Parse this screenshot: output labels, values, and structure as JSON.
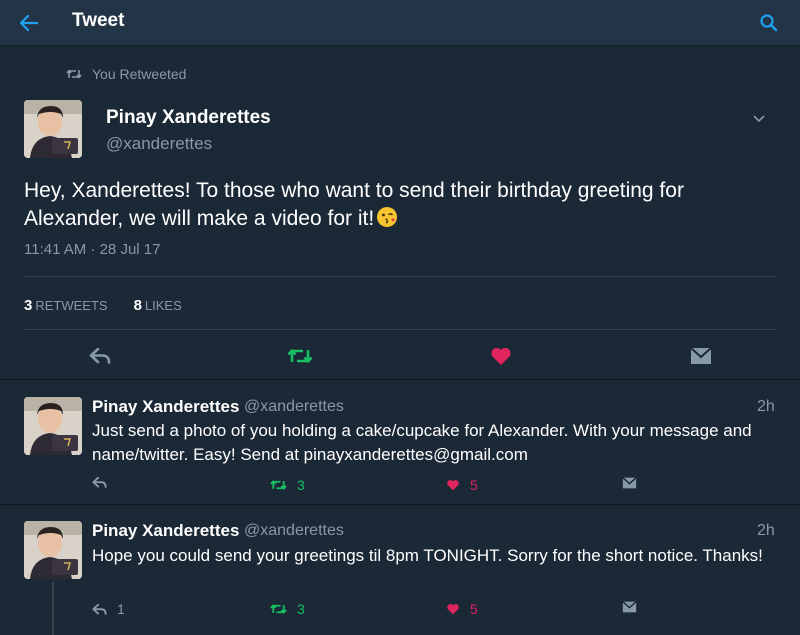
{
  "appbar": {
    "title": "Tweet"
  },
  "retweet_banner": {
    "label": "You Retweeted"
  },
  "main_tweet": {
    "name": "Pinay Xanderettes",
    "handle": "@xanderettes",
    "text": "Hey, Xanderettes! To those who want to send their birthday greeting for Alexander, we will make a video for it!",
    "timestamp": "11:41 AM · 28 Jul 17",
    "retweets_count": "3",
    "retweets_label": "RETWEETS",
    "likes_count": "8",
    "likes_label": "LIKES"
  },
  "replies": [
    {
      "name": "Pinay Xanderettes",
      "handle": "@xanderettes",
      "time": "2h",
      "text": "Just send a photo of you holding a cake/cupcake for Alexander. With your message and name/twitter. Easy! Send at pinayxanderettes@gmail.com",
      "reply_count": "",
      "retweet_count": "3",
      "like_count": "5"
    },
    {
      "name": "Pinay Xanderettes",
      "handle": "@xanderettes",
      "time": "2h",
      "text": "Hope you could send your greetings til 8pm TONIGHT. Sorry for the short notice. Thanks!",
      "reply_count": "1",
      "retweet_count": "3",
      "like_count": "5"
    }
  ],
  "colors": {
    "background": "#1b2836",
    "accent_blue": "#1da1f2",
    "retweet_green": "#17bf63",
    "like_pink": "#e0245e",
    "muted": "#8899a6"
  },
  "icons": {
    "back": "arrow-left-icon",
    "search": "search-icon",
    "retweet": "retweet-icon",
    "reply": "reply-icon",
    "like": "heart-icon",
    "dm": "envelope-icon",
    "caret": "chevron-down-icon",
    "emoji": "winking-kiss-emoji"
  }
}
